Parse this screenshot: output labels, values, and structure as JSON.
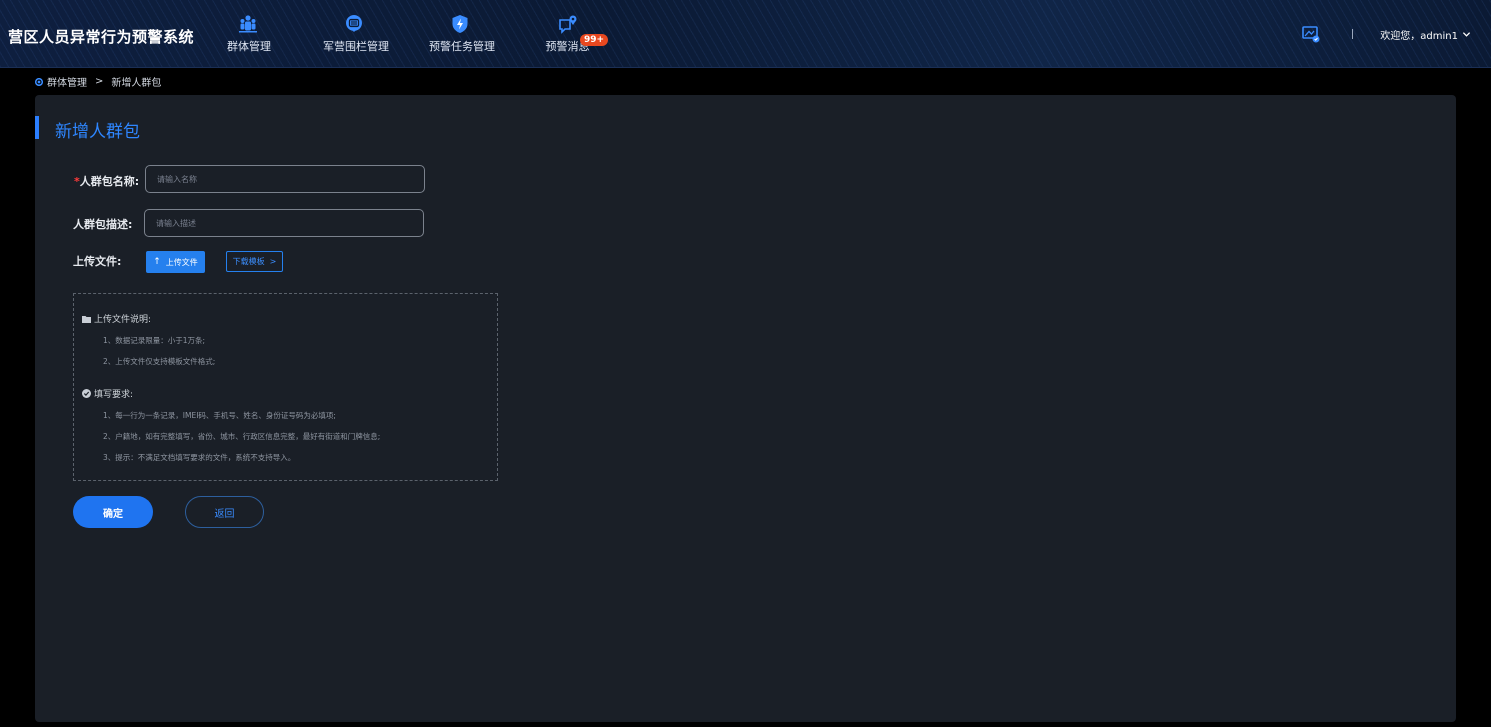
{
  "app": {
    "title": "营区人员异常行为预警系统"
  },
  "nav": [
    {
      "label": "群体管理",
      "icon": "group-icon"
    },
    {
      "label": "军营围栏管理",
      "icon": "fence-icon"
    },
    {
      "label": "预警任务管理",
      "icon": "shield-bolt-icon"
    },
    {
      "label": "预警消息",
      "icon": "message-pin-icon",
      "badge": "99+"
    }
  ],
  "header": {
    "welcome": "欢迎您，admin1",
    "divider": "|"
  },
  "breadcrumb": {
    "parent": "群体管理",
    "separator": ">",
    "current": "新增人群包"
  },
  "form": {
    "title": "新增人群包",
    "name_required_mark": "*",
    "name_label": "人群包名称:",
    "name_placeholder": "请输入名称",
    "name_value": "",
    "desc_label": "人群包描述:",
    "desc_placeholder": "请输入描述",
    "desc_value": "",
    "upload_label": "上传文件:",
    "upload_button": "上传文件",
    "download_button": "下载模板",
    "download_chevron": ">"
  },
  "instructions": {
    "upload_title": "上传文件说明:",
    "upload_items": [
      "1、数据记录限量：小于1万条;",
      "2、上传文件仅支持模板文件格式;"
    ],
    "fill_title": "填写要求:",
    "fill_items": [
      "1、每一行为一条记录，IMEI码、手机号、姓名、身份证号码为必填项;",
      "2、户籍地，如有完整填写，省份、城市、行政区信息完整，最好有街道和门牌信息;",
      "3、提示：不满足文档填写要求的文件，系统不支持导入。"
    ]
  },
  "actions": {
    "confirm": "确定",
    "back": "返回"
  },
  "colors": {
    "accent": "#2580ee",
    "panel": "#1a1f27",
    "badge": "#e8481f"
  }
}
